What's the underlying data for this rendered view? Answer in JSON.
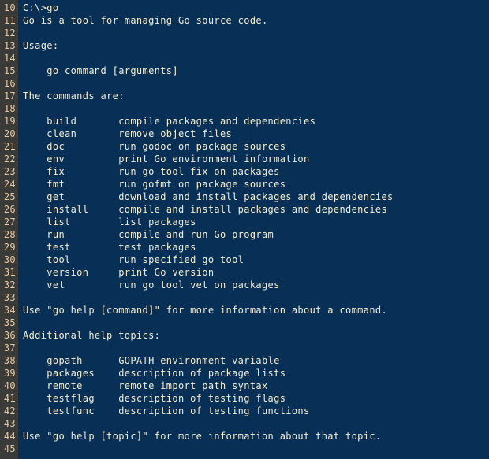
{
  "editor": {
    "gutter_bg": "#3a3a38",
    "code_bg": "#083056",
    "line_number_color": "#e8c9a0",
    "text_color": "#f5ecd0",
    "first_line_number": 10,
    "last_line_number": 45
  },
  "lines": [
    {
      "num": "10",
      "text": "C:\\>go"
    },
    {
      "num": "11",
      "text": "Go is a tool for managing Go source code."
    },
    {
      "num": "12",
      "text": ""
    },
    {
      "num": "13",
      "text": "Usage:"
    },
    {
      "num": "14",
      "text": ""
    },
    {
      "num": "15",
      "text": "    go command [arguments]"
    },
    {
      "num": "16",
      "text": ""
    },
    {
      "num": "17",
      "text": "The commands are:"
    },
    {
      "num": "18",
      "text": ""
    },
    {
      "num": "19",
      "text": "    build       compile packages and dependencies"
    },
    {
      "num": "20",
      "text": "    clean       remove object files"
    },
    {
      "num": "21",
      "text": "    doc         run godoc on package sources"
    },
    {
      "num": "22",
      "text": "    env         print Go environment information"
    },
    {
      "num": "23",
      "text": "    fix         run go tool fix on packages"
    },
    {
      "num": "24",
      "text": "    fmt         run gofmt on package sources"
    },
    {
      "num": "25",
      "text": "    get         download and install packages and dependencies"
    },
    {
      "num": "26",
      "text": "    install     compile and install packages and dependencies"
    },
    {
      "num": "27",
      "text": "    list        list packages"
    },
    {
      "num": "28",
      "text": "    run         compile and run Go program"
    },
    {
      "num": "29",
      "text": "    test        test packages"
    },
    {
      "num": "30",
      "text": "    tool        run specified go tool"
    },
    {
      "num": "31",
      "text": "    version     print Go version"
    },
    {
      "num": "32",
      "text": "    vet         run go tool vet on packages"
    },
    {
      "num": "33",
      "text": ""
    },
    {
      "num": "34",
      "text": "Use \"go help [command]\" for more information about a command."
    },
    {
      "num": "35",
      "text": ""
    },
    {
      "num": "36",
      "text": "Additional help topics:"
    },
    {
      "num": "37",
      "text": ""
    },
    {
      "num": "38",
      "text": "    gopath      GOPATH environment variable"
    },
    {
      "num": "39",
      "text": "    packages    description of package lists"
    },
    {
      "num": "40",
      "text": "    remote      remote import path syntax"
    },
    {
      "num": "41",
      "text": "    testflag    description of testing flags"
    },
    {
      "num": "42",
      "text": "    testfunc    description of testing functions"
    },
    {
      "num": "43",
      "text": ""
    },
    {
      "num": "44",
      "text": "Use \"go help [topic]\" for more information about that topic."
    },
    {
      "num": "45",
      "text": ""
    }
  ]
}
